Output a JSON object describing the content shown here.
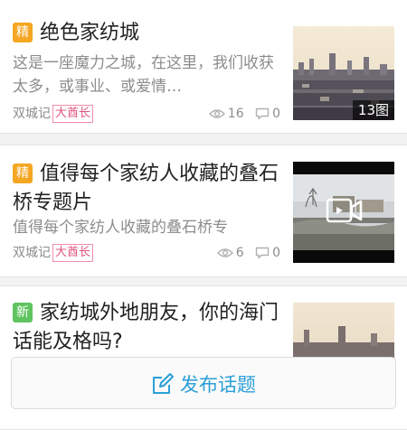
{
  "posts": [
    {
      "badge": "精",
      "badge_color": "#f5a623",
      "title": "绝色家纺城",
      "excerpt": "这是一座魔力之城，在这里，我们收获太多，或事业、或爱情…",
      "author": "双城记",
      "rank": "大酋长",
      "views": "16",
      "comments": "0",
      "thumb_icon": "photo-thumbnail",
      "image_count": "13图"
    },
    {
      "badge": "精",
      "badge_color": "#f5a623",
      "title": "值得每个家纺人收藏的叠石桥专题片",
      "excerpt": "值得每个家纺人收藏的叠石桥专",
      "author": "双城记",
      "rank": "大酋长",
      "views": "6",
      "comments": "0",
      "thumb_icon": "video-camera-icon"
    },
    {
      "badge": "新",
      "badge_color": "#5fc35f",
      "title": "家纺城外地朋友，你的海门话能及格吗?",
      "thumb_icon": "photo-thumbnail"
    }
  ],
  "publish": {
    "label": "发布话题",
    "icon": "edit-pen-icon",
    "accent": "#2a9fd8"
  },
  "icons": {
    "views": "eye-icon",
    "comments": "comment-bubble-icon"
  }
}
